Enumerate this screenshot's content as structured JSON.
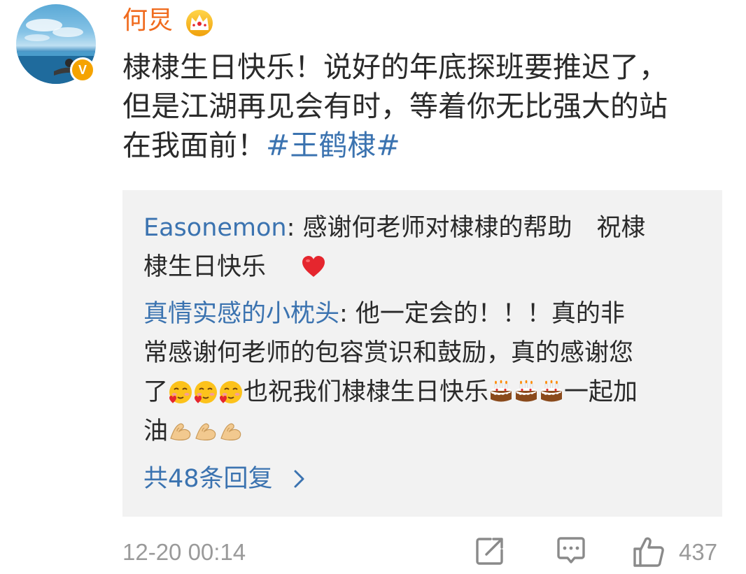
{
  "post": {
    "author": "何炅",
    "text_lines": [
      "棣棣生日快乐！说好的年底探班要推迟了，",
      "但是江湖再见会有时，等着你无比强大的站",
      "在我面前！"
    ],
    "hashtag": "#王鹤棣#",
    "timestamp": "12-20 00:14",
    "like_count": "437"
  },
  "replies": [
    {
      "author": "Easonemon",
      "line1": ": 感谢何老师对棣棣的帮助　祝棣",
      "line2": "棣生日快乐"
    },
    {
      "author": "真情实感的小枕头",
      "line1": ": 他一定会的！！！真的非",
      "line2": "常感谢何老师的包容赏识和鼓励，真的感谢您",
      "line3a": "了",
      "line3b": "也祝我们棣棣生日快乐",
      "line3c": "一起加",
      "line4": "油"
    }
  ],
  "more_replies": "共48条回复",
  "icons": {
    "crown": "crown-icon",
    "verified": "verified-v-badge",
    "heart": "red-heart-icon",
    "blush": "blush-heart-emoji",
    "cake": "birthday-cake-emoji",
    "muscle": "flexed-biceps-emoji",
    "share": "share-icon",
    "comment": "comment-icon",
    "like": "thumbs-up-icon"
  },
  "colors": {
    "username": "#f06b1e",
    "link": "#3b73b0",
    "text": "#2a2a2a",
    "meta": "#9a9a9a",
    "reply_bg": "#f2f2f2",
    "badge": "#f5a300"
  },
  "badge_letter": "V"
}
